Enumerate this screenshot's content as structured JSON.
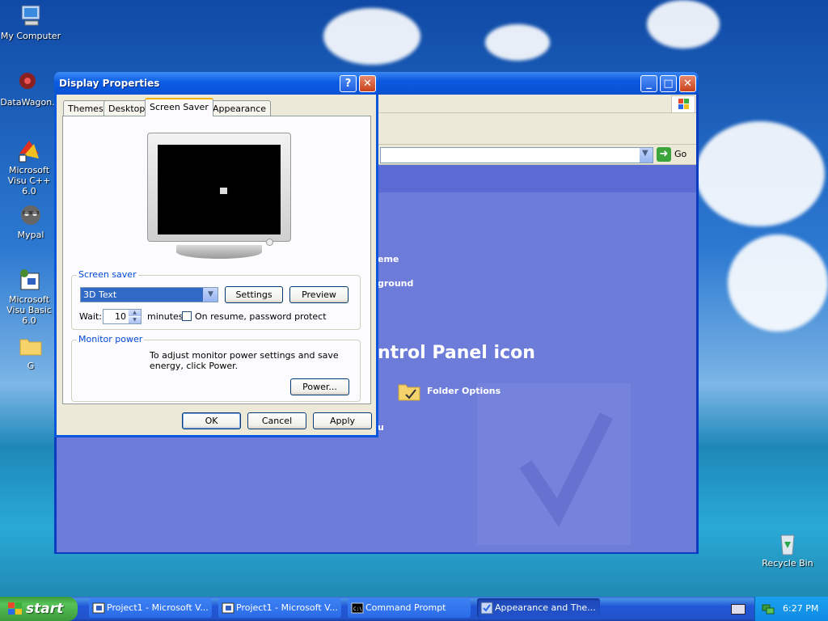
{
  "desktop": {
    "icons": [
      {
        "label": "My Computer"
      },
      {
        "label": "DataWagon."
      },
      {
        "label": "Microsoft Visu C++ 6.0"
      },
      {
        "label": "Mypal"
      },
      {
        "label": "Microsoft Visu Basic 6.0"
      },
      {
        "label": "G"
      },
      {
        "label": "Recycle Bin"
      }
    ]
  },
  "control_panel": {
    "go_label": "Go",
    "partial_texts": {
      "scheme": "eme",
      "background": "ground",
      "header": "ntrol Panel icon",
      "folder_options": "Folder Options",
      "stray": "u"
    }
  },
  "dialog": {
    "title": "Display Properties",
    "tabs": [
      "Themes",
      "Desktop",
      "Screen Saver",
      "Appearance"
    ],
    "active_tab": "Screen Saver",
    "screen_saver": {
      "group_label": "Screen saver",
      "selected": "3D Text",
      "settings_label": "Settings",
      "preview_label": "Preview",
      "wait_label": "Wait:",
      "wait_value": "10",
      "minutes_label": "minutes",
      "password_label": "On resume, password protect",
      "password_checked": false
    },
    "monitor_power": {
      "group_label": "Monitor power",
      "description": "To adjust monitor power settings and save energy, click Power.",
      "power_label": "Power..."
    },
    "buttons": {
      "ok": "OK",
      "cancel": "Cancel",
      "apply": "Apply"
    }
  },
  "taskbar": {
    "start_label": "start",
    "tasks": [
      {
        "label": "Project1 - Microsoft V..."
      },
      {
        "label": "Project1 - Microsoft V..."
      },
      {
        "label": "Command Prompt"
      },
      {
        "label": "Appearance and The..."
      }
    ],
    "clock": "6:27 PM"
  },
  "colors": {
    "xp_blue": "#0a56dc",
    "dialog_face": "#ece9d8",
    "cp_content": "#6d7bd9",
    "start_green": "#3a9a3a"
  }
}
